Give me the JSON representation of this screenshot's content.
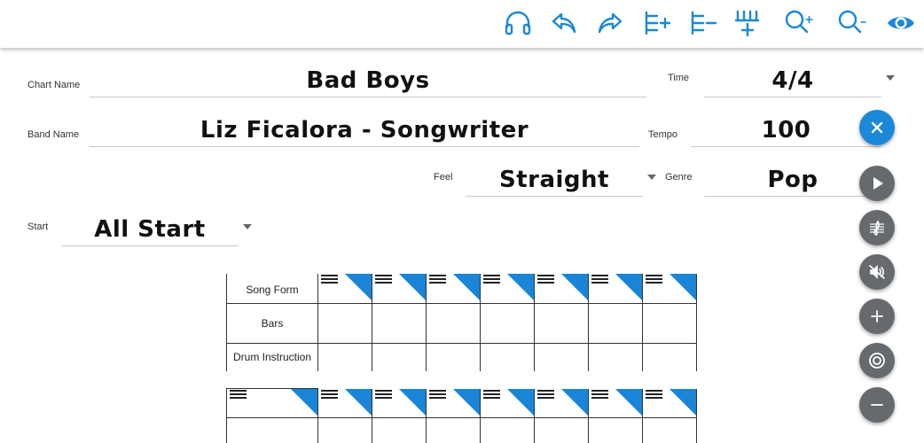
{
  "toolbar": {
    "icons": [
      "headphones-icon",
      "undo-icon",
      "redo-icon",
      "add-measure-icon",
      "remove-measure-icon",
      "add-line-icon",
      "zoom-in-icon",
      "zoom-out-icon",
      "eye-icon"
    ],
    "accent": "#1b88d8"
  },
  "form": {
    "chart_name_label": "Chart Name",
    "chart_name_value": "Bad Boys",
    "time_label": "Time",
    "time_value": "4/4",
    "band_name_label": "Band Name",
    "band_name_value": "Liz Ficalora - Songwriter",
    "tempo_label": "Tempo",
    "tempo_value": "100",
    "feel_label": "Feel",
    "feel_value": "Straight",
    "genre_label": "Genre",
    "genre_value": "Pop",
    "start_label": "Start",
    "start_value": "All Start"
  },
  "grid": {
    "rows": [
      "Song Form",
      "Bars",
      "Drum Instruction"
    ],
    "measure_count": 7,
    "marker_color": "#1a85d6"
  },
  "fabs": {
    "icons": [
      "close-icon",
      "play-icon",
      "notation-icon",
      "mute-icon",
      "plus-icon",
      "target-icon",
      "minus-icon"
    ]
  }
}
